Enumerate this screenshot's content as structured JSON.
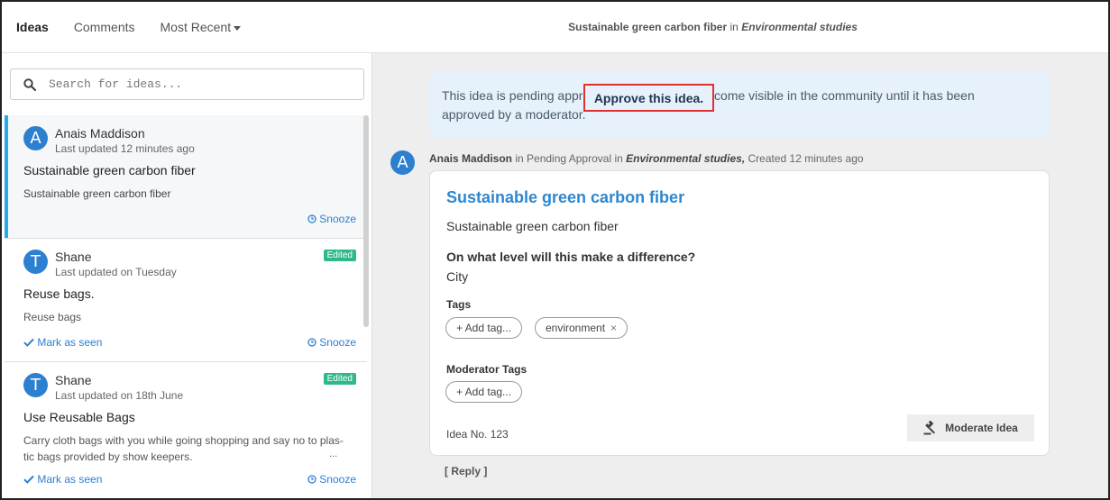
{
  "topbar": {
    "tabs": [
      {
        "label": "Ideas"
      },
      {
        "label": "Comments"
      },
      {
        "label": "Most Recent"
      }
    ],
    "breadcrumb": {
      "title": "Sustainable green carbon fiber",
      "in": "in",
      "category": "Environmental studies"
    }
  },
  "search": {
    "placeholder": "Search for ideas..."
  },
  "ideas": [
    {
      "avatar": "A",
      "author": "Anais Maddison",
      "updated": "Last updated 12 minutes ago",
      "title": "Sustainable green carbon fiber",
      "description": "Sustainable green carbon fiber",
      "snooze": "Snooze"
    },
    {
      "avatar": "T",
      "author": "Shane",
      "updated": "Last updated on Tuesday",
      "badge": "Edited",
      "title": "Reuse bags.",
      "description": "Reuse bags",
      "mark_seen": "Mark as seen",
      "snooze": "Snooze"
    },
    {
      "avatar": "T",
      "author": "Shane",
      "updated": "Last updated on 18th June",
      "badge": "Edited",
      "title": "Use Reusable Bags",
      "description_line1": "Carry cloth bags with you while going shopping and say no to plas-",
      "description_line2": "tic bags provided by show keepers.",
      "ellipsis": "...",
      "mark_seen": "Mark as seen",
      "snooze": "Snooze"
    }
  ],
  "pending": {
    "line1": "This idea is pending approval. This idea won't become visible in the community until it has been",
    "line2": "approved by a moderator.",
    "approve_label": "Approve this idea."
  },
  "detail": {
    "avatar": "A",
    "author": "Anais Maddison",
    "status_text": "in Pending Approval in",
    "category": "Environmental studies,",
    "created": "Created 12 minutes ago",
    "title": "Sustainable green carbon fiber",
    "description": "Sustainable green carbon fiber",
    "question": "On what level will this make a difference?",
    "answer": "City",
    "tags_label": "Tags",
    "add_tag": "+ Add tag...",
    "tags": [
      "environment"
    ],
    "moderator_tags_label": "Moderator Tags",
    "moderator_add_tag": "+ Add tag...",
    "idea_number": "Idea No. 123",
    "moderate_label": "Moderate Idea",
    "reply_label": "[ Reply ]"
  },
  "icons": {
    "search": "search-icon",
    "clock": "clock-icon",
    "check": "check-icon",
    "gavel": "gavel-icon",
    "close": "close-icon"
  },
  "colors": {
    "accent": "#2d87d0",
    "badge": "#2fb98a",
    "selected_bar": "#2aa9e8",
    "highlight_border": "#e03131",
    "pending_bg": "#e6f1fb"
  }
}
